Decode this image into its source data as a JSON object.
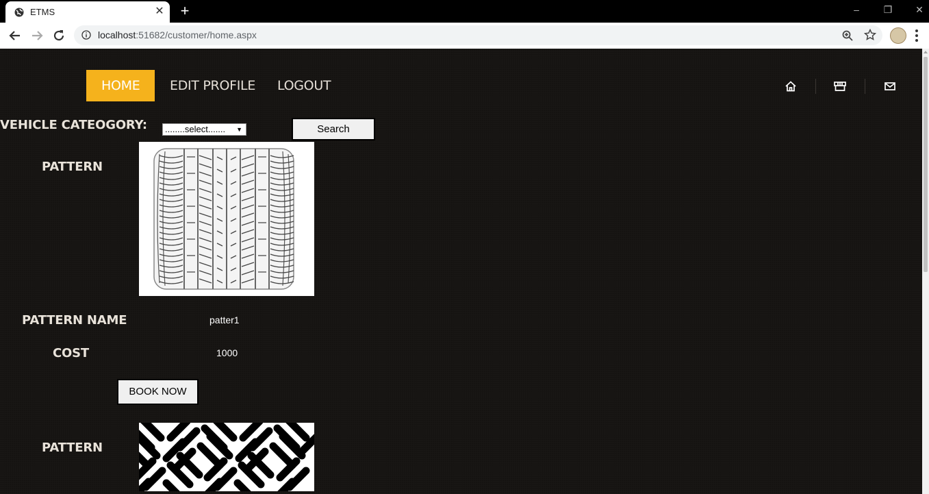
{
  "browser": {
    "tab_title": "ETMS",
    "tab_close": "✕",
    "new_tab": "+",
    "url_host": "localhost",
    "url_rest": ":51682/customer/home.aspx",
    "window_controls": [
      "–",
      "❐",
      "✕"
    ]
  },
  "nav": {
    "items": [
      {
        "label": "HOME",
        "active": true
      },
      {
        "label": "EDIT PROFILE",
        "active": false
      },
      {
        "label": "LOGOUT",
        "active": false
      }
    ],
    "icons": [
      "home-icon",
      "store-icon",
      "mail-icon"
    ]
  },
  "filter": {
    "label": "VEHICLE CATEOGORY:",
    "select_value": "........select.......",
    "search_label": "Search"
  },
  "items": [
    {
      "pattern_label": "PATTERN",
      "image": "tire-tread-image",
      "name_label": "PATTERN NAME",
      "name_value": "patter1",
      "cost_label": "COST",
      "cost_value": "1000",
      "book_label": "BOOK NOW"
    },
    {
      "pattern_label": "PATTERN",
      "image": "herringbone-tread-image"
    }
  ],
  "colors": {
    "accent": "#f5b21c",
    "background": "#151311",
    "text": "#e9e3da"
  }
}
